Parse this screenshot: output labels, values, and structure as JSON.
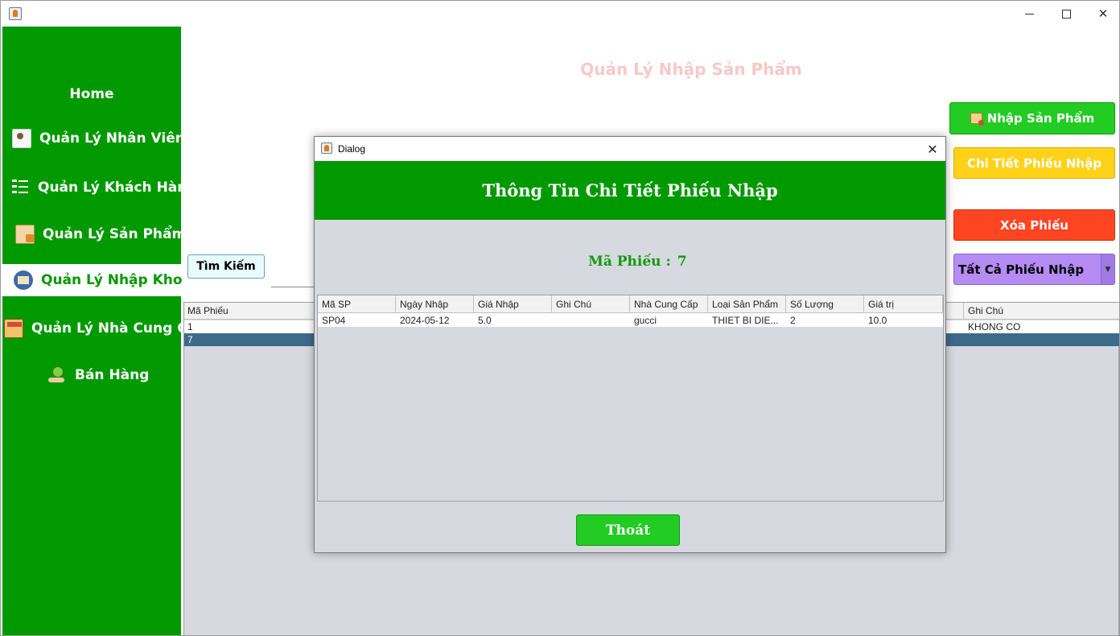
{
  "window": {
    "minimize_glyph": "",
    "close_glyph": "✕"
  },
  "sidebar": {
    "items": [
      {
        "label": "Home",
        "icon": "none"
      },
      {
        "label": "Quản Lý Nhân Viên",
        "icon": "employee-icon"
      },
      {
        "label": "Quản Lý Khách Hàng",
        "icon": "customer-list-icon"
      },
      {
        "label": "Quản Lý Sản Phẩm",
        "icon": "product-clipboard-icon"
      },
      {
        "label": "Quản Lý Nhập Kho",
        "icon": "warehouse-icon",
        "active": true
      },
      {
        "label": "Quản Lý Nhà Cung Cấp",
        "icon": "supplier-store-icon"
      },
      {
        "label": "Bán Hàng",
        "icon": "sales-hand-icon"
      }
    ]
  },
  "main": {
    "title": "Quản Lý Nhập Sản Phẩm",
    "buttons": {
      "nhap": "Nhập Sản Phẩm",
      "chitiet": "Chi Tiết Phiếu Nhập",
      "xoa": "Xóa Phiếu",
      "search": "Tìm Kiếm"
    },
    "filter": {
      "selected": "Tất Cả Phiếu Nhập"
    },
    "table": {
      "columns": [
        "Mã Phiếu",
        "Ghi Chú"
      ],
      "rows": [
        {
          "ma": "1",
          "ghichu": "KHONG CO"
        },
        {
          "ma": "7",
          "ghichu": "",
          "selected": true
        }
      ]
    }
  },
  "dialog": {
    "title": "Dialog",
    "close_glyph": "✕",
    "header": "Thông Tin Chi Tiết Phiếu Nhập",
    "ma_label": "Mã Phiếu :",
    "ma_value": "7",
    "columns": [
      "Mã SP",
      "Ngày Nhập",
      "Giá Nhập",
      "Ghi Chú",
      "Nhà Cung Cấp",
      "Loại Sản Phẩm",
      "Số Lượng",
      "Giá trị"
    ],
    "rows": [
      [
        "SP04",
        "2024-05-12",
        "5.0",
        "",
        "gucci",
        "THIET BI DIE...",
        "2",
        "10.0"
      ]
    ],
    "exit_button": "Thoát"
  },
  "colors": {
    "sidebar_bg": "#009900",
    "active_text": "#009900",
    "title_pink": "#f8c8c8",
    "nhap_green": "#22cc22",
    "chitiet_yellow": "#ffd21a",
    "xoa_red": "#ff4422",
    "filter_purple": "#b48cf4",
    "selected_row": "#3d6a8a",
    "dialog_bg": "#d6d9df"
  }
}
